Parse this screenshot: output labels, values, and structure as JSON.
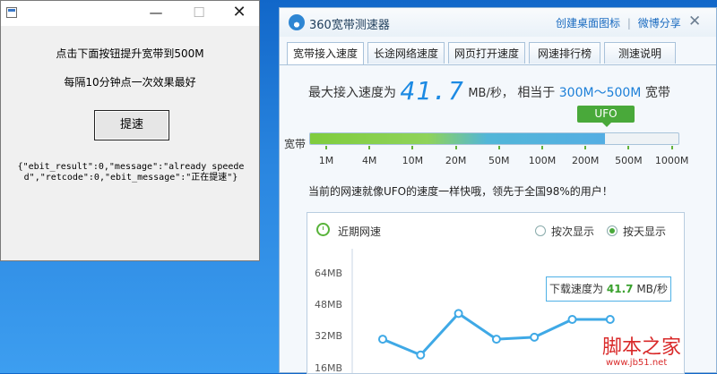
{
  "dialog": {
    "minimize_glyph": "—",
    "maximize_glyph": "☐",
    "close_glyph": "✕",
    "line1": "点击下面按钮提升宽带到500M",
    "line2": "每隔10分钟点一次效果最好",
    "button_label": "提速",
    "response": "{\"ebit_result\":0,\"message\":\"already speeded\",\"retcode\":0,\"ebit_message\":\"正在提速\"}"
  },
  "app": {
    "title": "360宽带测速器",
    "link_desktop": "创建桌面图标",
    "link_weibo": "微博分享",
    "close_glyph": "✕",
    "tabs": [
      {
        "label": "宽带接入速度"
      },
      {
        "label": "长途网络速度"
      },
      {
        "label": "网页打开速度"
      },
      {
        "label": "网速排行榜"
      },
      {
        "label": "测速说明"
      }
    ],
    "speed_prefix": "最大接入速度为",
    "speed_value": "41.7",
    "speed_unit": "MB/秒，",
    "equiv_prefix": "相当于",
    "equiv_range": "300M～500M",
    "equiv_suffix": "宽带",
    "bandwidth_label": "宽带",
    "bar_fill_percent": 80,
    "ufo_label": "UFO",
    "ticks": [
      "1M",
      "4M",
      "10M",
      "20M",
      "50M",
      "100M",
      "200M",
      "500M",
      "1000M"
    ],
    "description": "当前的网速就像UFO的速度一样快哦，领先于全国98%的用户！",
    "recent": {
      "title": "近期网速",
      "radio_by_count": "按次显示",
      "radio_by_day": "按天显示",
      "selected": "按天显示",
      "tooltip_prefix": "下载速度为",
      "tooltip_value": "41.7",
      "tooltip_unit": "MB/秒",
      "y_ticks": [
        "64MB",
        "48MB",
        "32MB",
        "16MB"
      ]
    }
  },
  "watermark": {
    "text": "脚本之家",
    "url": "www.jb51.net"
  },
  "chart_data": {
    "type": "line",
    "title": "近期网速",
    "y_ticks": [
      "64MB",
      "48MB",
      "32MB",
      "16MB"
    ],
    "ylim": [
      0,
      64
    ],
    "series": [
      {
        "values": [
          30,
          22,
          43,
          30,
          31,
          40,
          40
        ]
      }
    ],
    "grid": false,
    "accent_color": "#3fa9e6"
  }
}
